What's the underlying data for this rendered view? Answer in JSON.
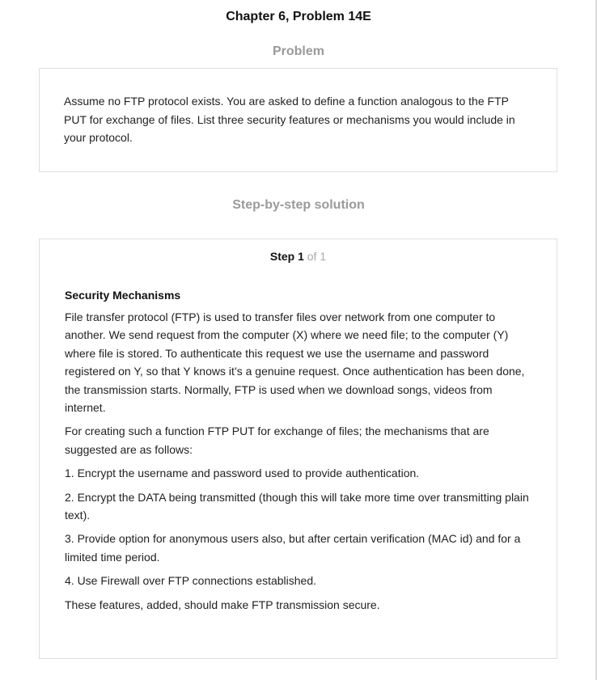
{
  "page": {
    "title": "Chapter 6, Problem 14E"
  },
  "problem": {
    "heading": "Problem",
    "text": "Assume no FTP protocol exists. You are asked to define a function analogous to the FTP PUT for exchange of files. List three security features or mechanisms you would include in your protocol."
  },
  "solution": {
    "heading": "Step-by-step solution",
    "step": {
      "label": "Step 1",
      "of": "of 1"
    },
    "subheading": "Security Mechanisms",
    "paragraphs": [
      "File transfer protocol (FTP) is used to transfer files over network from one computer to another. We send request from the computer (X) where we need file; to the computer (Y) where file is stored. To authenticate this request we use the username and password registered on Y, so that Y knows it’s a genuine request. Once authentication has been done, the transmission starts. Normally, FTP is used when we download songs, videos from internet.",
      "For creating such a function FTP PUT for exchange of files; the mechanisms that are suggested are as follows:",
      "1. Encrypt the username and password used to provide authentication.",
      "2. Encrypt the DATA being transmitted (though this will take more time over transmitting plain text).",
      "3. Provide option for anonymous users also, but after certain verification (MAC id) and for a limited time period.",
      "4. Use Firewall over FTP connections established.",
      "These features, added, should make FTP transmission secure."
    ]
  },
  "colors": {
    "heading_muted": "#9a9a9a",
    "border": "#dedede",
    "step_of": "#a8a8a8"
  }
}
